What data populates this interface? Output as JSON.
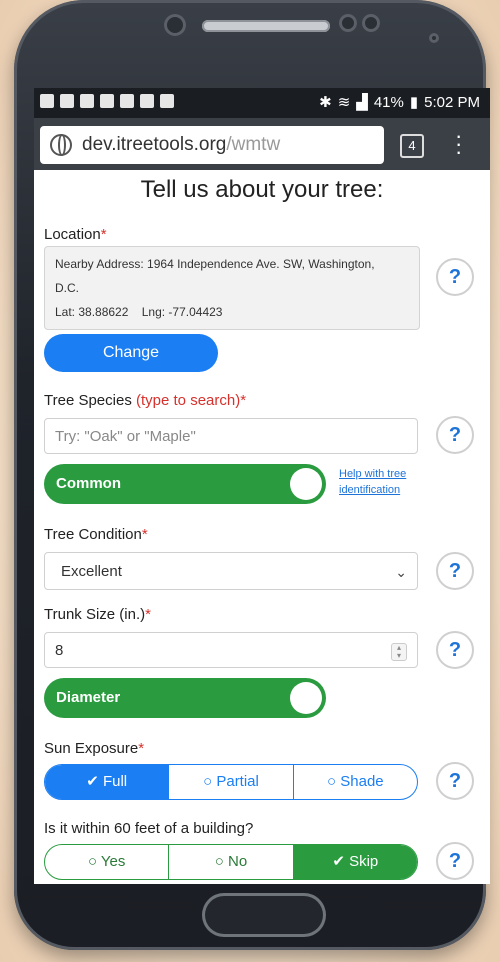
{
  "status": {
    "battery": "41%",
    "time": "5:02 PM"
  },
  "browser": {
    "url_host": "dev.itreetools.org",
    "url_path": "/wmtw",
    "tab_count": "4"
  },
  "page": {
    "title": "Tell us about your tree:"
  },
  "location": {
    "label": "Location",
    "address": "Nearby Address: 1964 Independence Ave. SW, Washington,",
    "address_cont": "D.C.",
    "latlng": "Lat: 38.88622    Lng: -77.04423",
    "change_button": "Change"
  },
  "species": {
    "label": "Tree Species",
    "hint": "(type to search)",
    "placeholder": "Try: \"Oak\" or \"Maple\"",
    "toggle_label": "Common",
    "help_link_line1": "Help with tree",
    "help_link_line2": "identification"
  },
  "condition": {
    "label": "Tree Condition",
    "value": "Excellent"
  },
  "trunk": {
    "label": "Trunk Size (in.)",
    "value": "8",
    "toggle_label": "Diameter"
  },
  "sun": {
    "label": "Sun Exposure",
    "options": [
      "Full",
      "Partial",
      "Shade"
    ],
    "selected": "Full"
  },
  "building": {
    "label": "Is it within 60 feet of a building?",
    "options": [
      "Yes",
      "No",
      "Skip"
    ],
    "selected": "Skip"
  },
  "common": {
    "required_mark": "*",
    "help_q": "?"
  }
}
